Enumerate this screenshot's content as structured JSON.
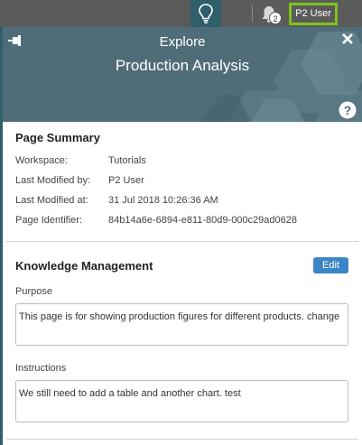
{
  "topbar": {
    "notification_count": "2",
    "user_label": "P2 User",
    "icons": [
      "lightbulb-icon",
      "bell-icon"
    ]
  },
  "panel": {
    "kicker": "Explore",
    "title": "Production Analysis",
    "header_color": "#4f6d78",
    "icons": [
      "pin-icon",
      "close-icon",
      "help-icon"
    ]
  },
  "summary": {
    "heading": "Page Summary",
    "rows": [
      {
        "label": "Workspace:",
        "value": "Tutorials"
      },
      {
        "label": "Last Modified by:",
        "value": "P2 User"
      },
      {
        "label": "Last Modified at:",
        "value": "31 Jul 2018 10:26:36 AM"
      },
      {
        "label": "Page Identifier:",
        "value": "84b14a6e-6894-e811-80d9-000c29ad0628"
      }
    ]
  },
  "knowledge": {
    "heading": "Knowledge Management",
    "edit_label": "Edit",
    "purpose_label": "Purpose",
    "purpose_text": "This page is  for showing production figures for different products. change",
    "instructions_label": "Instructions",
    "instructions_text": "We still need to add a table and another chart. test"
  },
  "colors": {
    "accent": "#3c85c6",
    "user_border": "#7fc31c",
    "topbar": "#5b5b5b"
  }
}
